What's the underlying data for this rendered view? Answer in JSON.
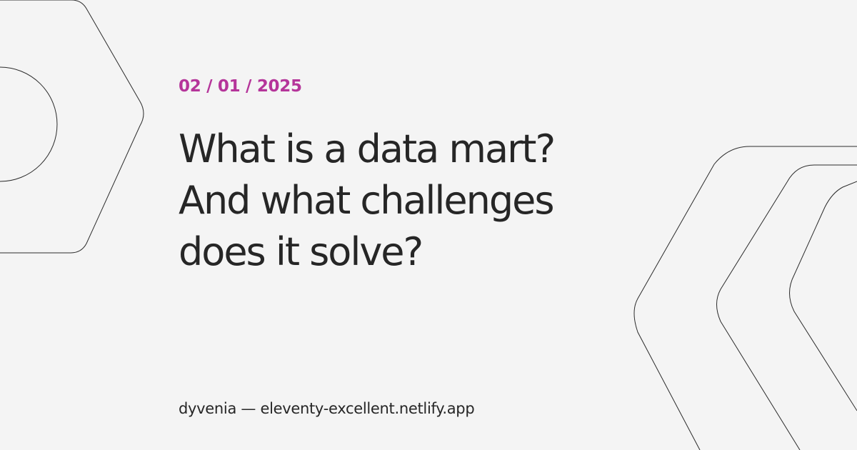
{
  "card": {
    "date": "02 / 01 / 2025",
    "title": "What is a data mart? And what challenges does it solve?",
    "footer": "dyvenia — eleventy-excellent.netlify.app",
    "accent_color": "#b5359a",
    "text_color": "#262626",
    "background_color": "#f4f4f4"
  }
}
